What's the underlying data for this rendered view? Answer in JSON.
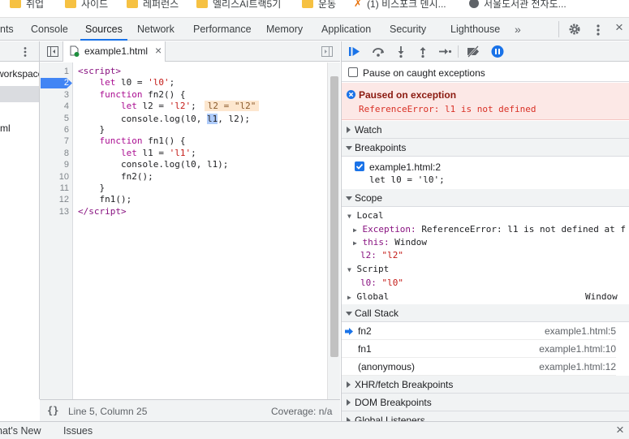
{
  "bookmarks": [
    {
      "label": "취업",
      "icon": "folder-icon"
    },
    {
      "label": "사이드",
      "icon": "folder-icon"
    },
    {
      "label": "레퍼런스",
      "icon": "folder-icon"
    },
    {
      "label": "엘리스AI트랙5기",
      "icon": "folder-icon"
    },
    {
      "label": "운동",
      "icon": "folder-icon"
    },
    {
      "label": "(1) 비스포크 덴시...",
      "icon": "site-icon"
    },
    {
      "label": "서울도서관 전자도...",
      "icon": "globe-icon"
    }
  ],
  "devtools_tabs": [
    "nts",
    "Console",
    "Sources",
    "Network",
    "Performance",
    "Memory",
    "Application",
    "Security",
    "Lighthouse"
  ],
  "active_tab": "Sources",
  "more_tabs_glyph": "»",
  "navigator": {
    "row1": "workspace",
    "row3": "ml"
  },
  "editor": {
    "file_tab": "example1.html",
    "close_glyph": "×",
    "line_numbers": [
      "1",
      "2",
      "3",
      "4",
      "5",
      "6",
      "7",
      "8",
      "9",
      "10",
      "11",
      "12",
      "13"
    ],
    "inline_value": "l2 = \"l2\""
  },
  "status": {
    "braces": "{}",
    "position": "Line 5, Column 25",
    "coverage": "Coverage: n/a"
  },
  "debugger": {
    "pause_checkbox_label": "Pause on caught exceptions",
    "paused_title": "Paused on exception",
    "paused_error": "ReferenceError: l1 is not defined",
    "watch": "Watch",
    "breakpoints": "Breakpoints",
    "breakpoint_file": "example1.html:2",
    "breakpoint_code": "let l0 = 'l0';",
    "scope": "Scope",
    "local": "Local",
    "exception_key": "Exception:",
    "exception_val": "ReferenceError: l1 is not defined at f",
    "this_key": "this:",
    "this_val": "Window",
    "l2_key": "l2:",
    "l2_val": "\"l2\"",
    "script": "Script",
    "l0_key": "l0:",
    "l0_val": "\"l0\"",
    "global": "Global",
    "global_val": "Window",
    "call_stack": "Call Stack",
    "frames": [
      {
        "name": "fn2",
        "loc": "example1.html:5"
      },
      {
        "name": "fn1",
        "loc": "example1.html:10"
      },
      {
        "name": "(anonymous)",
        "loc": "example1.html:12"
      }
    ],
    "xhr": "XHR/fetch Breakpoints",
    "dom": "DOM Breakpoints",
    "global_listeners": "Global Listeners"
  },
  "drawer": {
    "whats_new": "nat's New",
    "issues": "Issues",
    "close": "×"
  },
  "colors": {
    "accent": "#1a73e8",
    "error": "#d93025",
    "keyword": "#aa0d91",
    "string": "#c41a16"
  }
}
